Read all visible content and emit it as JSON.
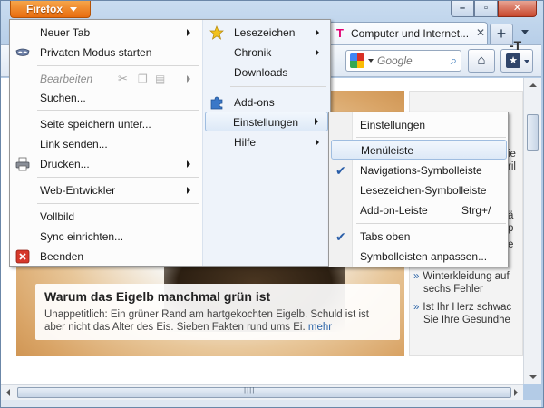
{
  "window": {
    "app_button_label": "Firefox",
    "minimize_glyph": "–",
    "maximize_glyph": "▫",
    "close_glyph": "✕"
  },
  "tabs": {
    "active_tab_title": "Computer und Internet...",
    "active_tab_logo": "T",
    "close_glyph": "✕",
    "new_tab_glyph": "+"
  },
  "navbar": {
    "search_placeholder": "Google",
    "home_icon": "home-icon",
    "bookmarks_icon": "bookmarks-menu-icon"
  },
  "main_menu": {
    "left": [
      {
        "label": "Neuer Tab",
        "submenu": true
      },
      {
        "label": "Privaten Modus starten",
        "icon": "private-browsing-icon"
      },
      {
        "label": "Bearbeiten",
        "disabled": true,
        "submenu": true
      },
      {
        "label": "Suchen..."
      },
      {
        "label": "Seite speichern unter..."
      },
      {
        "label": "Link senden..."
      },
      {
        "label": "Drucken...",
        "icon": "printer-icon",
        "submenu": true
      },
      {
        "label": "Web-Entwickler",
        "submenu": true
      },
      {
        "label": "Vollbild"
      },
      {
        "label": "Sync einrichten..."
      },
      {
        "label": "Beenden",
        "icon": "quit-icon"
      }
    ],
    "right": [
      {
        "label": "Lesezeichen",
        "icon": "star-icon",
        "submenu": true
      },
      {
        "label": "Chronik",
        "submenu": true
      },
      {
        "label": "Downloads"
      },
      {
        "label": "Add-ons",
        "icon": "puzzle-icon"
      },
      {
        "label": "Einstellungen",
        "submenu": true,
        "highlighted": true
      },
      {
        "label": "Hilfe",
        "submenu": true
      }
    ]
  },
  "settings_submenu": {
    "items": [
      {
        "label": "Einstellungen"
      },
      {
        "label": "Menüleiste",
        "highlighted": true
      },
      {
        "label": "Navigations-Symbolleiste",
        "checked": true
      },
      {
        "label": "Lesezeichen-Symbolleiste"
      },
      {
        "label": "Add-on-Leiste",
        "shortcut": "Strg+/"
      },
      {
        "label": "Tabs oben",
        "checked": true
      },
      {
        "label": "Symbolleisten anpassen..."
      }
    ],
    "check_glyph": "✔"
  },
  "page": {
    "teaser_title": "Warum das Eigelb manchmal grün ist",
    "teaser_text": "Unappetitlich: Ein grüner Rand am hartgekochten Eigelb. Schuld ist ist aber nicht das Alter des Eis. Sieben Fakten rund ums Ei.",
    "teaser_more": "mehr",
    "sidebar_heading_fragment": "-T",
    "sidebar_fragments": [
      "ie",
      "ril",
      "ä",
      "p",
      "e"
    ],
    "sidebar_links": [
      {
        "line1": "Winterkleidung auf",
        "line2": "sechs Fehler"
      },
      {
        "line1": "Ist Ihr Herz schwac",
        "line2": "Sie Ihre Gesundhe"
      }
    ],
    "bullet_glyph": "»"
  },
  "colors": {
    "firefox_orange": "#e86c0e",
    "menu_highlight": "#dde9f7",
    "link_blue": "#2b64a8"
  }
}
